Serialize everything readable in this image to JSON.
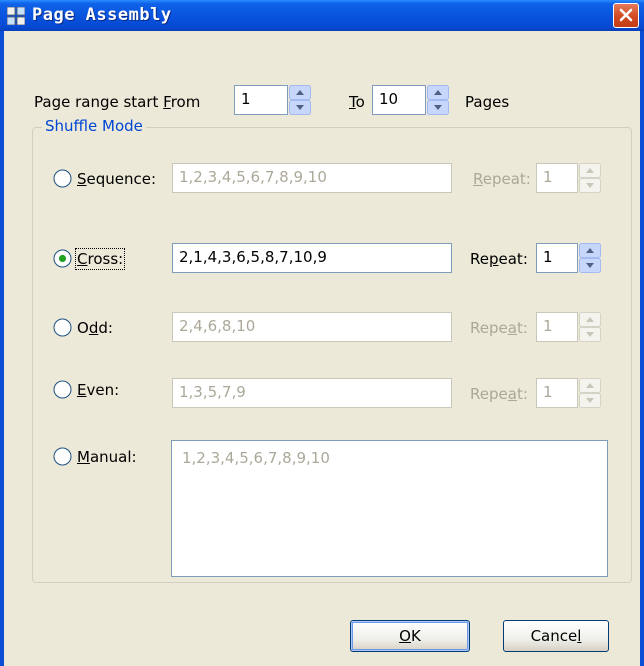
{
  "window": {
    "title": "Page Assembly",
    "close_icon": "close-icon"
  },
  "range": {
    "prefix": "Page range start ",
    "from_hotkey": "F",
    "from_rest": "rom",
    "from_value": "1",
    "to_hotkey": "T",
    "to_rest": "o",
    "to_value": "10",
    "pages_label": "Pages"
  },
  "shuffle": {
    "group_label": "Shuffle Mode",
    "selected": "cross",
    "modes": {
      "sequence": {
        "hk_pre": "",
        "hotkey": "S",
        "rest": "equence:",
        "value": "1,2,3,4,5,6,7,8,9,10",
        "repeat_pre": "",
        "repeat_hotkey": "R",
        "repeat_rest": "epeat:",
        "repeat_value": "1"
      },
      "cross": {
        "hk_pre": "",
        "hotkey": "C",
        "rest": "ross:",
        "value": "2,1,4,3,6,5,8,7,10,9",
        "repeat_pre": "Re",
        "repeat_hotkey": "p",
        "repeat_rest": "eat:",
        "repeat_value": "1"
      },
      "odd": {
        "hk_pre": "O",
        "hotkey": "d",
        "rest": "d:",
        "value": "2,4,6,8,10",
        "repeat_pre": "Repe",
        "repeat_hotkey": "a",
        "repeat_rest": "t:",
        "repeat_value": "1"
      },
      "even": {
        "hk_pre": "",
        "hotkey": "E",
        "rest": "ven:",
        "value": "1,3,5,7,9",
        "repeat_pre": "Repe",
        "repeat_hotkey": "a",
        "repeat_rest": "t:",
        "repeat_value": "1"
      },
      "manual": {
        "hk_pre": "",
        "hotkey": "M",
        "rest": "anual:",
        "value": "1,2,3,4,5,6,7,8,9,10"
      }
    }
  },
  "buttons": {
    "ok_hotkey": "O",
    "ok_rest": "K",
    "cancel_pre": "Cance",
    "cancel_hotkey": "l"
  },
  "colors": {
    "titlebar": "#0a54df",
    "client_bg": "#ece9d8",
    "group_label": "#0046d5",
    "disabled_text": "#aca899",
    "radio_dot": "#21a121"
  }
}
